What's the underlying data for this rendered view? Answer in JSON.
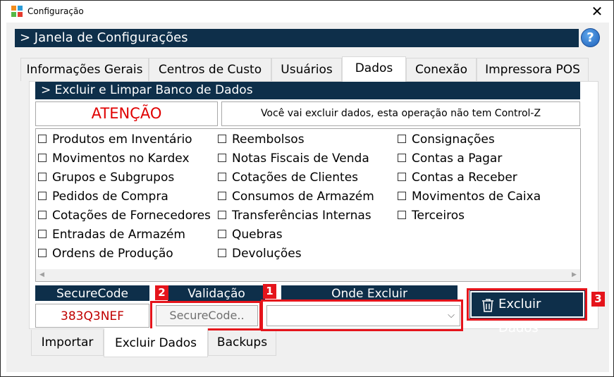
{
  "window": {
    "title": "Configuração",
    "close_glyph": "✕"
  },
  "header": {
    "title": "> Janela de Configurações",
    "help_glyph": "?"
  },
  "top_tabs": [
    {
      "label": "Informações Gerais"
    },
    {
      "label": "Centros de Custo"
    },
    {
      "label": "Usuários"
    },
    {
      "label": "Dados"
    },
    {
      "label": "Conexão"
    },
    {
      "label": "Impressora POS"
    }
  ],
  "active_top_tab": "Dados",
  "section": {
    "title": "> Excluir e Limpar Banco de Dados"
  },
  "attention": {
    "label": "ATENÇÃO",
    "message": "Você vai excluir dados, esta operação não tem Control-Z"
  },
  "checkboxes": {
    "col1": [
      "Produtos em Inventário",
      "Movimentos no Kardex",
      "Grupos e Subgrupos",
      "Pedidos de Compra",
      "Cotações de Fornecedores",
      "Entradas de Armazém",
      "Ordens de Produção"
    ],
    "col2": [
      "Reembolsos",
      "Notas Fiscais de Venda",
      "Cotações de Clientes",
      "Consumos de Armazém",
      "Transferências Internas",
      "Quebras",
      "Devoluções"
    ],
    "col3": [
      "Consignações",
      "Contas a Pagar",
      "Contas a Receber",
      "Movimentos de Caixa",
      "Terceiros"
    ]
  },
  "form": {
    "securecode_label": "SecureCode",
    "securecode_value": "383Q3NEF",
    "validacao_label": "Validação",
    "validacao_placeholder": "SecureCode..",
    "onde_label": "Onde Excluir",
    "onde_value": ""
  },
  "badges": {
    "b1": "1",
    "b2": "2",
    "b3": "3"
  },
  "action": {
    "label": "Excluir Dados",
    "icon": "trash-icon"
  },
  "bottom_tabs": [
    {
      "label": "Importar"
    },
    {
      "label": "Excluir Dados"
    },
    {
      "label": "Backups"
    }
  ],
  "colors": {
    "navy": "#0e2f4a",
    "annotation_red": "#e5141b",
    "attention_red": "#e00000"
  }
}
